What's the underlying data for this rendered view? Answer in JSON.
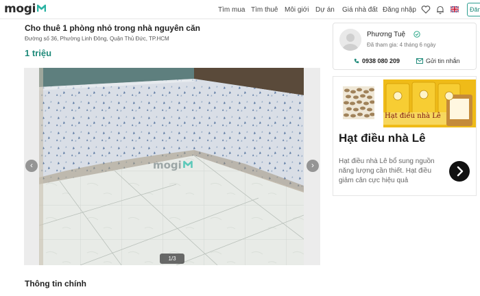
{
  "header": {
    "logo_text": "mogi",
    "nav": [
      "Tìm mua",
      "Tìm thuê",
      "Môi giới",
      "Dự án",
      "Giá nhà đất",
      "Đăng nhập"
    ],
    "login_partial": "Đăn",
    "colors": {
      "brand": "#2bb3a3",
      "accent": "#1f8a7a"
    },
    "icons": [
      "heart-icon",
      "bell-icon",
      "uk-flag-icon"
    ]
  },
  "listing": {
    "title": "Cho thuê 1 phòng nhỏ trong nhà nguyên căn",
    "address": "Đường số 36, Phường Linh Đông, Quận Thủ Đức, TP.HCM",
    "price": "1 triệu",
    "gallery": {
      "watermark": "mogi",
      "counter": "1/3"
    },
    "section_title": "Thông tin chính"
  },
  "agent": {
    "name": "Phương Tuệ",
    "joined": "Đã tham gia: 4 tháng 6 ngày",
    "phone": "0938 080 209",
    "message_label": "Gửi tin nhắn"
  },
  "ad": {
    "image_caption": "Hạt điều nhà Lê",
    "title": "Hạt điều nhà Lê",
    "description": "Hạt điều nhà Lê bổ sung nguồn năng lượng cần thiết. Hạt điều giảm cân cực hiệu quả"
  }
}
